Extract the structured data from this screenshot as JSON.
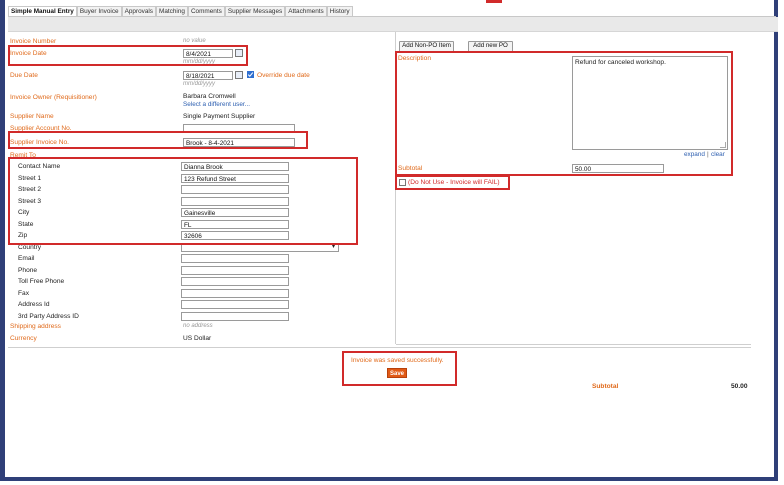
{
  "tabs": [
    "Simple Manual Entry",
    "Buyer Invoice",
    "Approvals",
    "Matching",
    "Comments",
    "Supplier Messages",
    "Attachments",
    "History"
  ],
  "left": {
    "invoice_number": {
      "label": "Invoice Number",
      "value": "no value"
    },
    "invoice_date": {
      "label": "Invoice Date",
      "value": "8/4/2021",
      "hint": "mm/dd/yyyy"
    },
    "due_date": {
      "label": "Due Date",
      "value": "8/18/2021",
      "hint": "mm/dd/yyyy",
      "override_label": "Override due date"
    },
    "invoice_owner": {
      "label": "Invoice Owner (Requisitioner)",
      "value": "Barbara Cromwell",
      "link": "Select a different user..."
    },
    "supplier_name": {
      "label": "Supplier Name",
      "value": "Single Payment Supplier"
    },
    "supplier_account": {
      "label": "Supplier Account No.",
      "value": ""
    },
    "supplier_invoice": {
      "label": "Supplier Invoice No.",
      "value": "Brook - 8-4-2021"
    },
    "remit_to": {
      "label": "Remit To"
    },
    "address": [
      {
        "label": "Contact Name",
        "value": "Dianna Brook"
      },
      {
        "label": "Street 1",
        "value": "123 Refund Street"
      },
      {
        "label": "Street 2",
        "value": ""
      },
      {
        "label": "Street 3",
        "value": ""
      },
      {
        "label": "City",
        "value": "Gainesville"
      },
      {
        "label": "State",
        "value": "FL"
      },
      {
        "label": "Zip",
        "value": "32606"
      },
      {
        "label": "Country",
        "value": ""
      },
      {
        "label": "Email",
        "value": ""
      },
      {
        "label": "Phone",
        "value": ""
      },
      {
        "label": "Toll Free Phone",
        "value": ""
      },
      {
        "label": "Fax",
        "value": ""
      },
      {
        "label": "Address Id",
        "value": ""
      },
      {
        "label": "3rd Party Address ID",
        "value": ""
      }
    ],
    "shipping": {
      "label": "Shipping address",
      "value": "no address"
    },
    "currency": {
      "label": "Currency",
      "value": "US Dollar"
    }
  },
  "right": {
    "add_non_po": "Add Non-PO Item",
    "add_new_po": "Add new PO",
    "description_label": "Description",
    "description_value": "Refund for canceled workshop.",
    "expand": "expand",
    "sep": "|",
    "clear": "clear",
    "subtotal_label": "Subtotal",
    "subtotal_value": "50.00",
    "do_not_use": "(Do Not Use - Invoice will FAIL)"
  },
  "footer": {
    "message": "Invoice was saved successfully.",
    "save": "Save",
    "subtotal_label": "Subtotal",
    "subtotal_value": "50.00"
  },
  "colors": {
    "label": "#e06a1b",
    "highlight": "#d12a2a",
    "frame": "#2f3f78",
    "save": "#e05a16"
  }
}
